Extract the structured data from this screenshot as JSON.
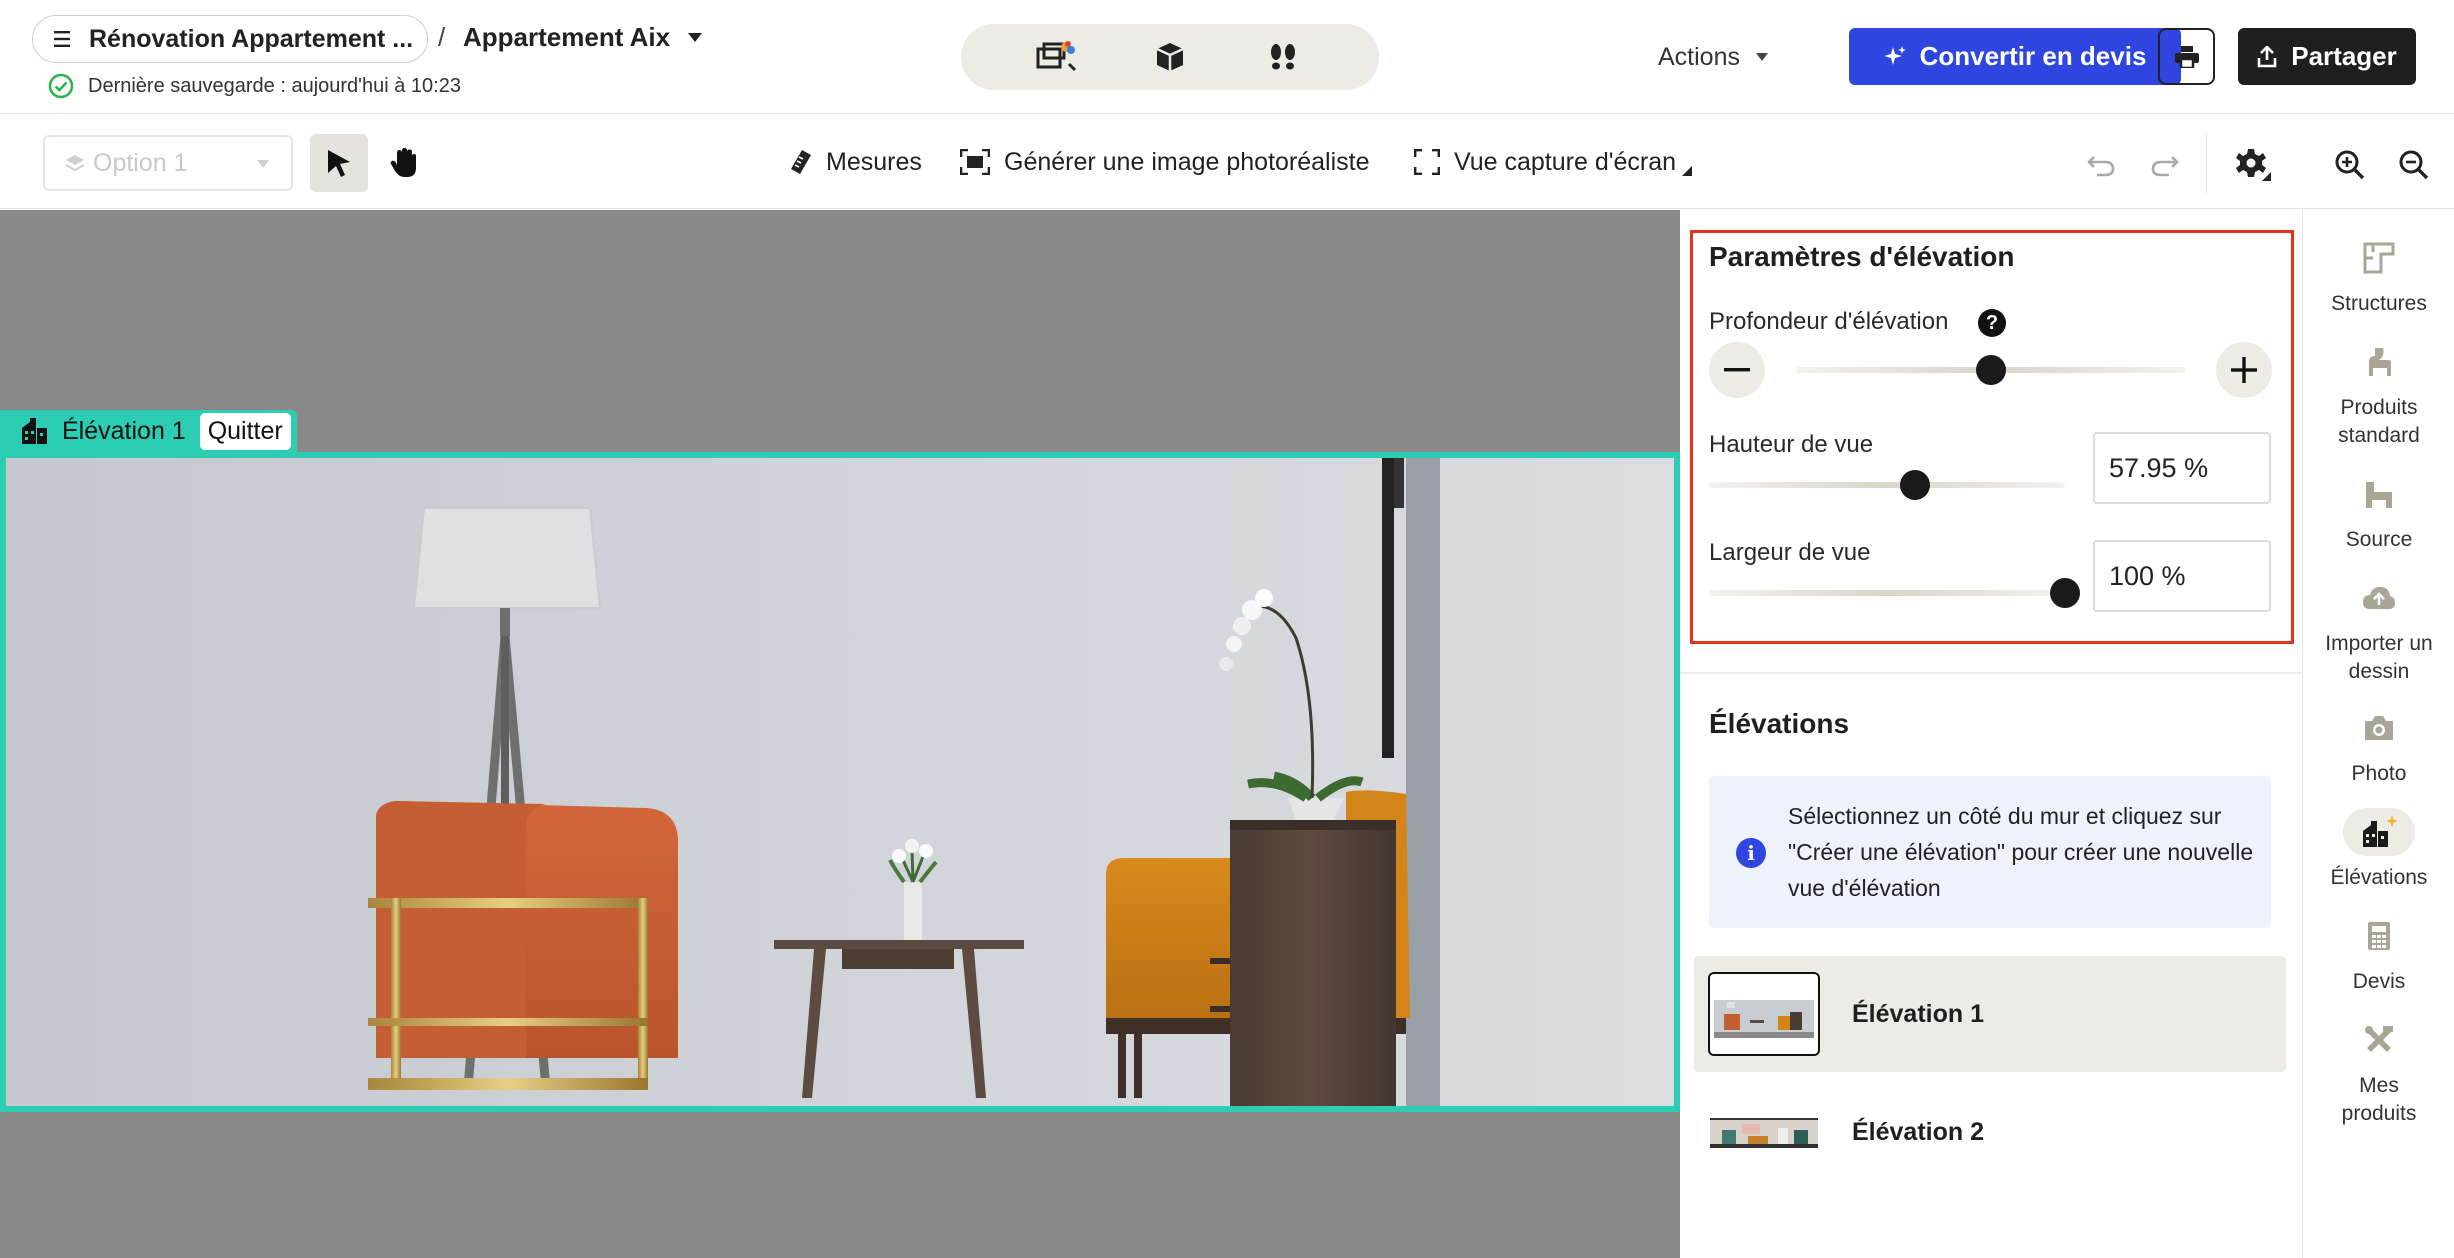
{
  "header": {
    "project_name": "Rénovation Appartement ...",
    "separator": "/",
    "room_name": "Appartement Aix",
    "save_status": "Dernière sauvegarde : aujourd'hui à 10:23",
    "actions_label": "Actions",
    "convert_label": "Convertir en devis",
    "share_label": "Partager",
    "mode_icons": [
      "plan-2d-3d-icon",
      "3d-box-icon",
      "footsteps-icon"
    ]
  },
  "toolbar": {
    "option_label": "Option 1",
    "measures_label": "Mesures",
    "photoreal_label": "Générer une image photoréaliste",
    "capture_label": "Vue capture d'écran"
  },
  "canvas": {
    "elevation_tag": "Élévation 1",
    "quit_label": "Quitter"
  },
  "params": {
    "title": "Paramètres d'élévation",
    "depth_label": "Profondeur d'élévation",
    "depth_level": 0.5,
    "height_label": "Hauteur de vue",
    "height_value": "57.95 %",
    "height_level": 0.5795,
    "width_label": "Largeur de vue",
    "width_value": "100 %",
    "width_level": 1.0
  },
  "elevations": {
    "title": "Élévations",
    "info": "Sélectionnez un côté du mur et cliquez sur \"Créer une élévation\" pour créer une nouvelle vue d'élévation",
    "items": [
      {
        "label": "Élévation 1",
        "selected": true
      },
      {
        "label": "Élévation 2",
        "selected": false
      }
    ]
  },
  "rail": {
    "items": [
      {
        "label": "Structures",
        "icon": "structures-icon"
      },
      {
        "label": "Produits standard",
        "icon": "products-icon"
      },
      {
        "label": "Source",
        "icon": "source-icon"
      },
      {
        "label": "Importer un dessin",
        "icon": "upload-cloud-icon"
      },
      {
        "label": "Photo",
        "icon": "camera-icon"
      },
      {
        "label": "Élévations",
        "icon": "elevations-icon",
        "active": true
      },
      {
        "label": "Devis",
        "icon": "calculator-icon"
      },
      {
        "label": "Mes produits",
        "icon": "my-products-icon"
      }
    ]
  },
  "colors": {
    "accent_blue": "#2f45e0",
    "teal": "#2ccdb2",
    "highlight_red": "#e2341d",
    "canvas_gray": "#898989"
  }
}
